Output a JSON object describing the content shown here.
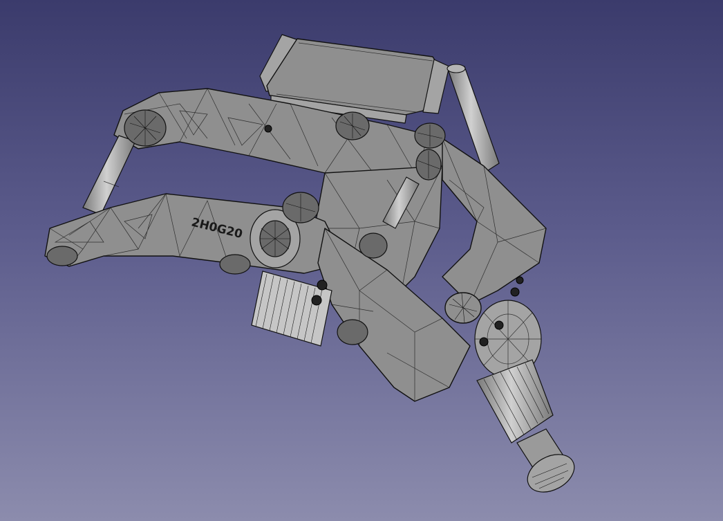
{
  "viewport": {
    "background_top": "#3b3b6c",
    "background_bottom": "#8c8cad",
    "model_color": "#8f8f8f",
    "mesh_color": "#151515"
  },
  "model": {
    "engraving_text": "2H0G20"
  }
}
